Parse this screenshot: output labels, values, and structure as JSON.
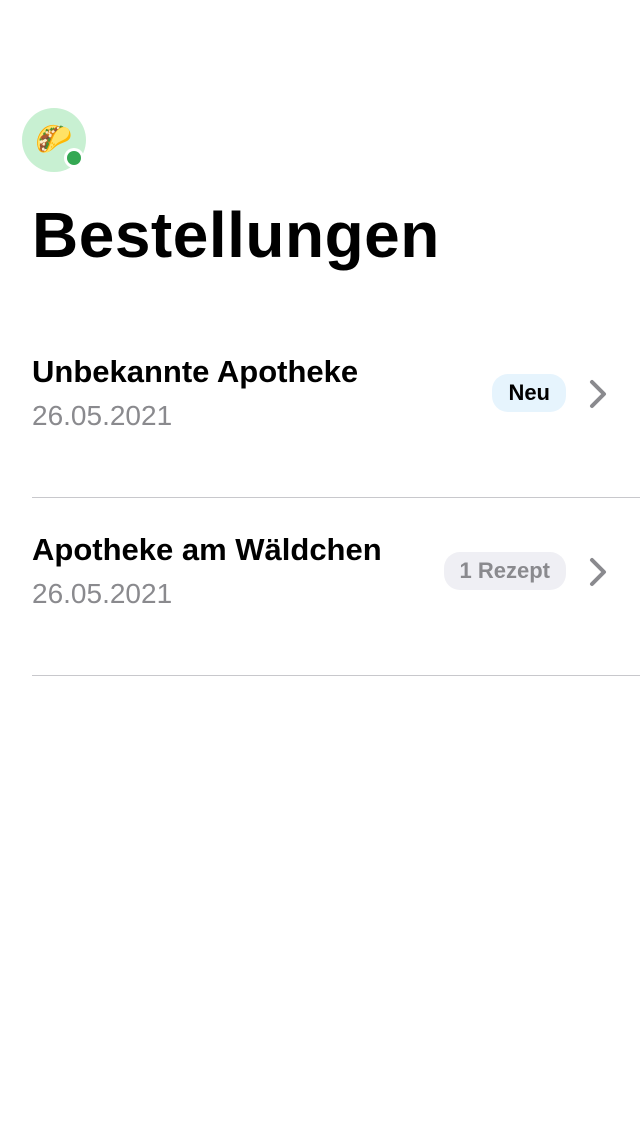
{
  "header": {
    "title": "Bestellungen",
    "avatar": {
      "emoji": "🌮",
      "icon": "taco-icon",
      "status": "online",
      "status_color": "#34a853"
    }
  },
  "orders": [
    {
      "pharmacy": "Unbekannte Apotheke",
      "date": "26.05.2021",
      "badge": "Neu",
      "badge_bg": "#e6f4fd",
      "badge_color": "#000000",
      "chevron_icon": "chevron-right-icon"
    },
    {
      "pharmacy": "Apotheke am Wäldchen",
      "date": "26.05.2021",
      "badge": "1 Rezept",
      "badge_bg": "#efeff4",
      "badge_color": "#8a8a8e",
      "chevron_icon": "chevron-right-icon"
    }
  ],
  "colors": {
    "background": "#ffffff",
    "divider": "#c8c8cc",
    "secondary_text": "#8a8a8e",
    "chevron": "#8a8a8e"
  }
}
